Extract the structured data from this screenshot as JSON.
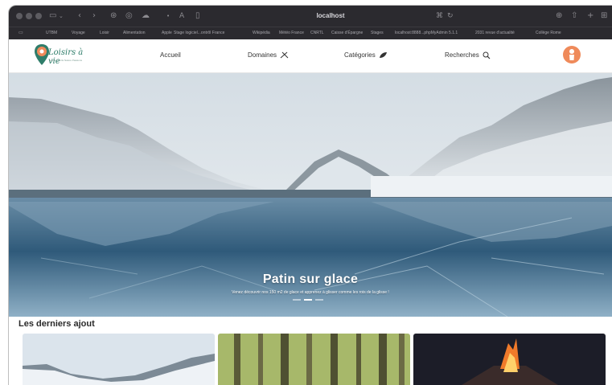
{
  "browser": {
    "url": "localhost",
    "bookmarks": [
      "UTBM",
      "Voyage",
      "Loisir",
      "Alimentation",
      "Apple",
      "Stage logiciel...ontrôl France",
      "Wikipédia",
      "Météo France",
      "CNRTL",
      "Caisse d'Épargne",
      "Stages",
      "localhost:8888...phpMyAdmin 5.1.1",
      "2031 revue d'actualité",
      "Collège Rome"
    ]
  },
  "header": {
    "logo_text": "Loisirs à vie",
    "logo_tagline": "Loisirs Sports Nature Passions",
    "nav": {
      "home": "Accueil",
      "domains": "Domaines",
      "categories": "Catégories",
      "search": "Recherches"
    }
  },
  "hero": {
    "title": "Patin sur glace",
    "subtitle": "Venez découvrir nos 150 m2 de glace et apprenez à glisser comme les rois de la glisse !",
    "slide_count": 3,
    "active_slide": 2
  },
  "latest": {
    "title": "Les derniers ajout",
    "cards": [
      {
        "image": "snowy-mountain-lake"
      },
      {
        "image": "forest"
      },
      {
        "image": "volcano-eruption"
      }
    ]
  },
  "colors": {
    "chrome": "#2b2a2f",
    "accent": "#ef8a5a",
    "logo_green": "#2f7d6a"
  }
}
